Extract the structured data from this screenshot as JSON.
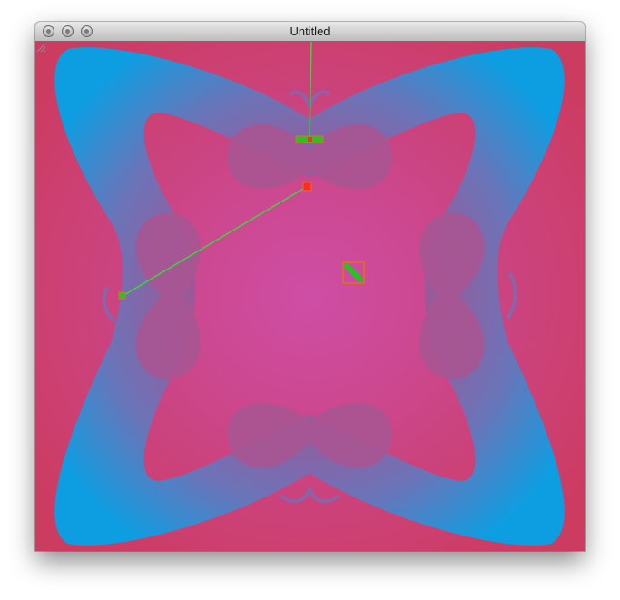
{
  "window": {
    "title": "Untitled"
  },
  "icons": {
    "close": "close-button-icon",
    "minimize": "minimize-button-icon",
    "zoom": "zoom-button-icon",
    "resize": "resize-grip-icon"
  },
  "colors": {
    "background_edge": "#cc3b60",
    "background_center": "#cf4ea6",
    "shape_inner": "#9a5aa0",
    "shape_outer": "#1a9ade",
    "handle_line": "#3fd33f",
    "handle_fill": "#22c522",
    "handle_border": "#e07018",
    "handle_point": "#ff2a2a"
  }
}
